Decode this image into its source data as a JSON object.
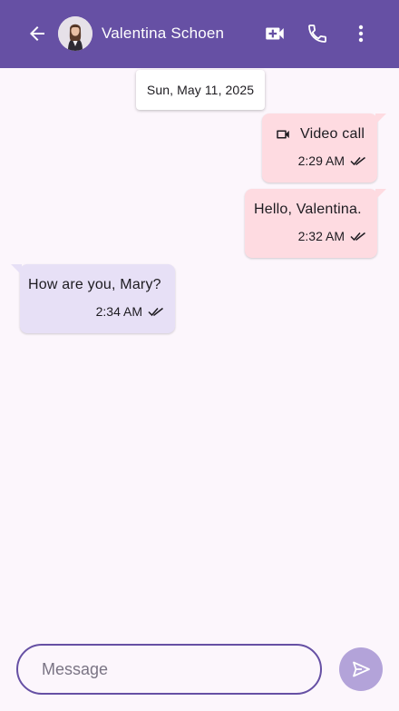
{
  "header": {
    "contact_name": "Valentina Schoen",
    "background_color": "#6650a4",
    "icons": {
      "back": "arrow-left-icon",
      "video": "add-video-call-icon",
      "phone": "phone-icon",
      "more": "more-vertical-icon"
    }
  },
  "date_chip": {
    "label": "Sun, May 11, 2025"
  },
  "messages": [
    {
      "direction": "outgoing",
      "type": "video-call",
      "text": "Video call",
      "time": "2:29 AM",
      "status_icon": "double-check-icon"
    },
    {
      "direction": "outgoing",
      "type": "text",
      "text": "Hello, Valentina.",
      "time": "2:32 AM",
      "status_icon": "double-check-icon"
    },
    {
      "direction": "incoming",
      "type": "text",
      "text": "How are you, Mary?",
      "time": "2:34 AM",
      "status_icon": "double-check-icon"
    }
  ],
  "composer": {
    "placeholder": "Message",
    "value": "",
    "send_icon": "send-icon"
  },
  "colors": {
    "outgoing_bubble": "#fedbe1",
    "incoming_bubble": "#e7e0f6",
    "background": "#fcf6fc",
    "send_button": "#b3a3d9"
  }
}
